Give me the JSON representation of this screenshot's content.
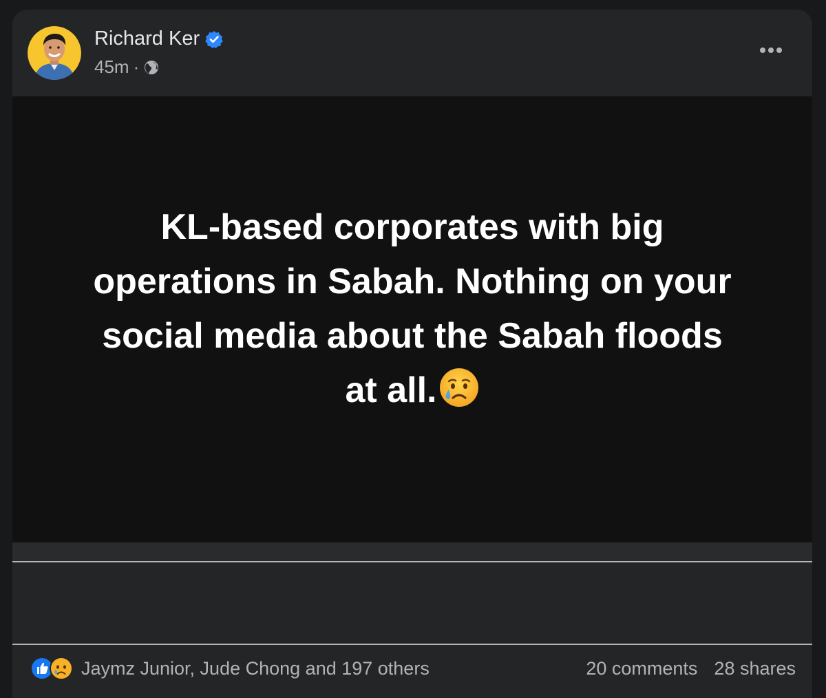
{
  "post": {
    "author": "Richard Ker",
    "verified": true,
    "time": "45m",
    "separator": "·",
    "audience_icon": "globe-icon",
    "text_lines": [
      "KL-based corporates with big",
      "operations in Sabah. Nothing on your",
      "social media about the Sabah floods",
      "at all."
    ],
    "text_emoji": "crying-face-emoji"
  },
  "footer": {
    "reaction_icons": [
      "like-icon",
      "sad-icon"
    ],
    "reaction_names": "Jaymz Junior, Jude Chong and 197 others",
    "comments": "20 comments",
    "shares": "28 shares"
  },
  "colors": {
    "page_bg": "#18191a",
    "card_bg": "#242526",
    "post_bg": "#111111",
    "primary_text": "#e4e6eb",
    "secondary_text": "#b0b3b8",
    "verified_blue": "#2d88ff",
    "like_blue": "#1877f2",
    "avatar_bg": "#f7c52d"
  }
}
